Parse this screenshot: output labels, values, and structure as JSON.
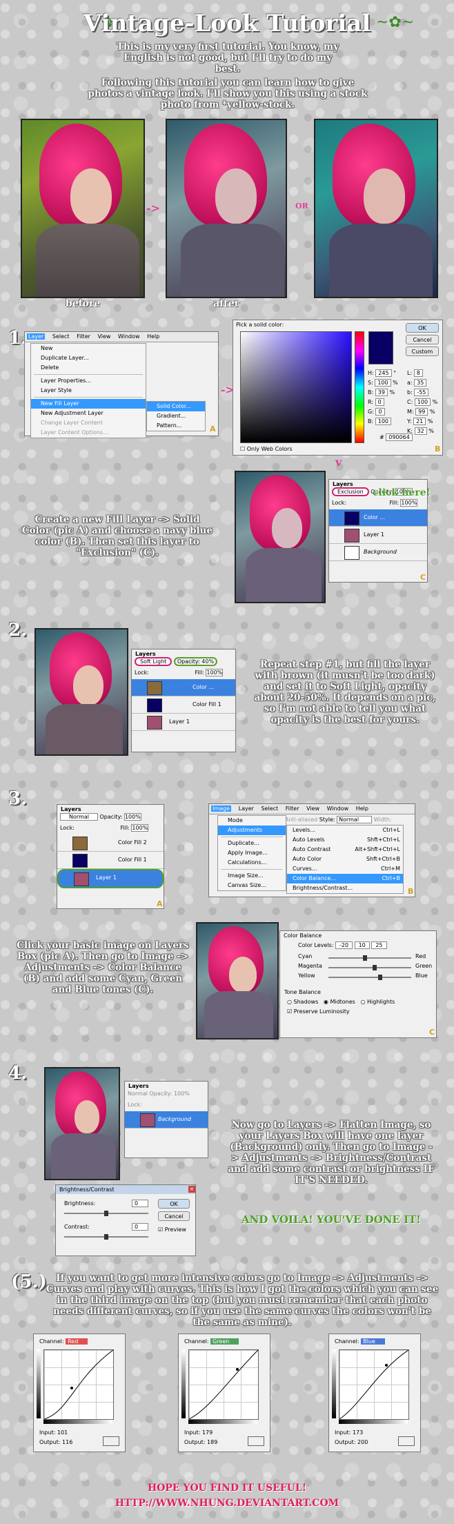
{
  "title": "Vintage-Look Tutorial",
  "intro1": "This is my very first tutorial. You know, my English is not good, but I'll try to do my best.",
  "intro2": "Following this tutorial you can learn how to give photos a vintage look. I'll show you this using a stock photo from *yellow-stock.",
  "compare": {
    "before": "before",
    "after": "after",
    "or": "OR",
    "arrow": "->"
  },
  "step1": {
    "num": "1.",
    "menubar": [
      "Layer",
      "Select",
      "Filter",
      "View",
      "Window",
      "Help"
    ],
    "menu": [
      "New",
      "Duplicate Layer...",
      "Delete",
      "Layer Properties...",
      "Layer Style",
      "New Fill Layer",
      "New Adjustment Layer",
      "Change Layer Content",
      "Layer Content Options..."
    ],
    "submenu": [
      "Solid Color...",
      "Gradient...",
      "Pattern..."
    ],
    "picker_title": "Pick a solid color:",
    "picker_buttons": [
      "OK",
      "Cancel",
      "Custom"
    ],
    "picker_fields": [
      {
        "k": "H:",
        "v": "245",
        "u": "°"
      },
      {
        "k": "S:",
        "v": "100",
        "u": "%"
      },
      {
        "k": "B:",
        "v": "39",
        "u": "%"
      },
      {
        "k": "R:",
        "v": "0",
        "u": ""
      },
      {
        "k": "G:",
        "v": "0",
        "u": ""
      },
      {
        "k": "B:",
        "v": "100",
        "u": ""
      }
    ],
    "picker_fields2": [
      {
        "k": "L:",
        "v": "8"
      },
      {
        "k": "a:",
        "v": "35"
      },
      {
        "k": "b:",
        "v": "-55"
      },
      {
        "k": "C:",
        "v": "100",
        "u": "%"
      },
      {
        "k": "M:",
        "v": "99",
        "u": "%"
      },
      {
        "k": "Y:",
        "v": "21",
        "u": "%"
      },
      {
        "k": "K:",
        "v": "32",
        "u": "%"
      }
    ],
    "hex_label": "#",
    "hex": "090064",
    "only_web": "Only Web Colors",
    "text": "Create a new Fill Layer -> Solid Color (pic A) and choose a navy blue color (B). Then set this layer to \"Exclusion\" (C).",
    "click_here": "click here!",
    "layers_tab": "Layers",
    "blend": "Exclusion",
    "opacity_label": "Opacity:",
    "opacity": "100%",
    "lock_label": "Lock:",
    "fill_label": "Fill:",
    "fill": "100%",
    "layers": [
      "Color ...",
      "Layer 1",
      "Background"
    ],
    "badges": [
      "A",
      "B",
      "C"
    ],
    "arrow": "->",
    "down_arrow": "v",
    "navy": "#090064"
  },
  "step2": {
    "num": "2.",
    "blend": "Soft Light",
    "opacity": "40%",
    "fill": "100%",
    "layers": [
      "Color ...",
      "Color Fill 1",
      "Layer 1"
    ],
    "text": "Repeat step #1, but fill the layer with brown (it musn't be too dark) and set it to Soft Light, opacity about 20-50%. It depends on a pic, so I'm not able to tell you what opacity is the best for yours.",
    "brown": "#8a6a3a"
  },
  "step3": {
    "num": "3.",
    "blend": "Normal",
    "opacity": "100%",
    "fill": "100%",
    "layers": [
      "Color Fill 2",
      "Color Fill 1",
      "Layer 1"
    ],
    "menubar": [
      "Image",
      "Layer",
      "Select",
      "Filter",
      "View",
      "Window",
      "Help"
    ],
    "menu": [
      "Mode",
      "Adjustments",
      "Duplicate...",
      "Apply Image...",
      "Calculations...",
      "Image Size...",
      "Canvas Size..."
    ],
    "style_label": "Style:",
    "style": "Normal",
    "antialiased": "Anti-aliased",
    "width_label": "Width:",
    "submenu": [
      {
        "name": "Levels...",
        "key": "Ctrl+L"
      },
      {
        "name": "Auto Levels",
        "key": "Shft+Ctrl+L"
      },
      {
        "name": "Auto Contrast",
        "key": "Alt+Shft+Ctrl+L"
      },
      {
        "name": "Auto Color",
        "key": "Shft+Ctrl+B"
      },
      {
        "name": "Curves...",
        "key": "Ctrl+M"
      },
      {
        "name": "Color Balance...",
        "key": "Ctrl+B"
      },
      {
        "name": "Brightness/Contrast...",
        "key": ""
      }
    ],
    "cb_title": "Color Balance",
    "cb_levels_label": "Color Levels:",
    "cb_levels": [
      "-20",
      "10",
      "25"
    ],
    "cb_rows": [
      [
        "Cyan",
        "Red"
      ],
      [
        "Magenta",
        "Green"
      ],
      [
        "Yellow",
        "Blue"
      ]
    ],
    "tone_title": "Tone Balance",
    "tones": [
      "Shadows",
      "Midtones",
      "Highlights"
    ],
    "preserve": "Preserve Luminosity",
    "text": "Click your basic image on Layers Box (pic A). Then go to Image -> Adjustments -> Color Balance (B) and add some Cyan, Green and Blue tones (C)."
  },
  "step4": {
    "num": "4.",
    "blend": "Normal",
    "opacity": "100%",
    "layer": "Background",
    "bc_title": "Brightness/Contrast",
    "brightness_label": "Brightness:",
    "brightness": "0",
    "contrast_label": "Contrast:",
    "contrast": "0",
    "buttons": [
      "OK",
      "Cancel"
    ],
    "preview": "Preview",
    "text": "Now go to Layers -> Flatten Image, so your Layers Box will have one layer (Background) only. Then go to Image -> Adjustments -> Brightness/Contrast and add some contrast or brightness IF IT'S NEEDED.",
    "voila": "AND VOILA! YOU'VE DONE IT!"
  },
  "step5": {
    "num": "(5.)",
    "text": "If you want to get more intensive colors go to Image -> Adjustments -> Curves and play with curves. This is how I got the colors which you can see in the third image on the top (but you must remember that each photo needs different curves, so if you use the same curves the colors won't be the same as mine).",
    "channel_label": "Channel:",
    "input_label": "Input:",
    "output_label": "Output:",
    "curves": [
      {
        "channel": "Red",
        "input": "101",
        "output": "116",
        "color": "#e05050"
      },
      {
        "channel": "Green",
        "input": "179",
        "output": "189",
        "color": "#50a060"
      },
      {
        "channel": "Blue",
        "input": "173",
        "output": "200",
        "color": "#4a7ad8"
      }
    ]
  },
  "footer": {
    "line1": "HOPE YOU FIND IT USEFUL!",
    "line2": "HTTP://WWW.NHUNG.DEVIANTART.COM"
  }
}
